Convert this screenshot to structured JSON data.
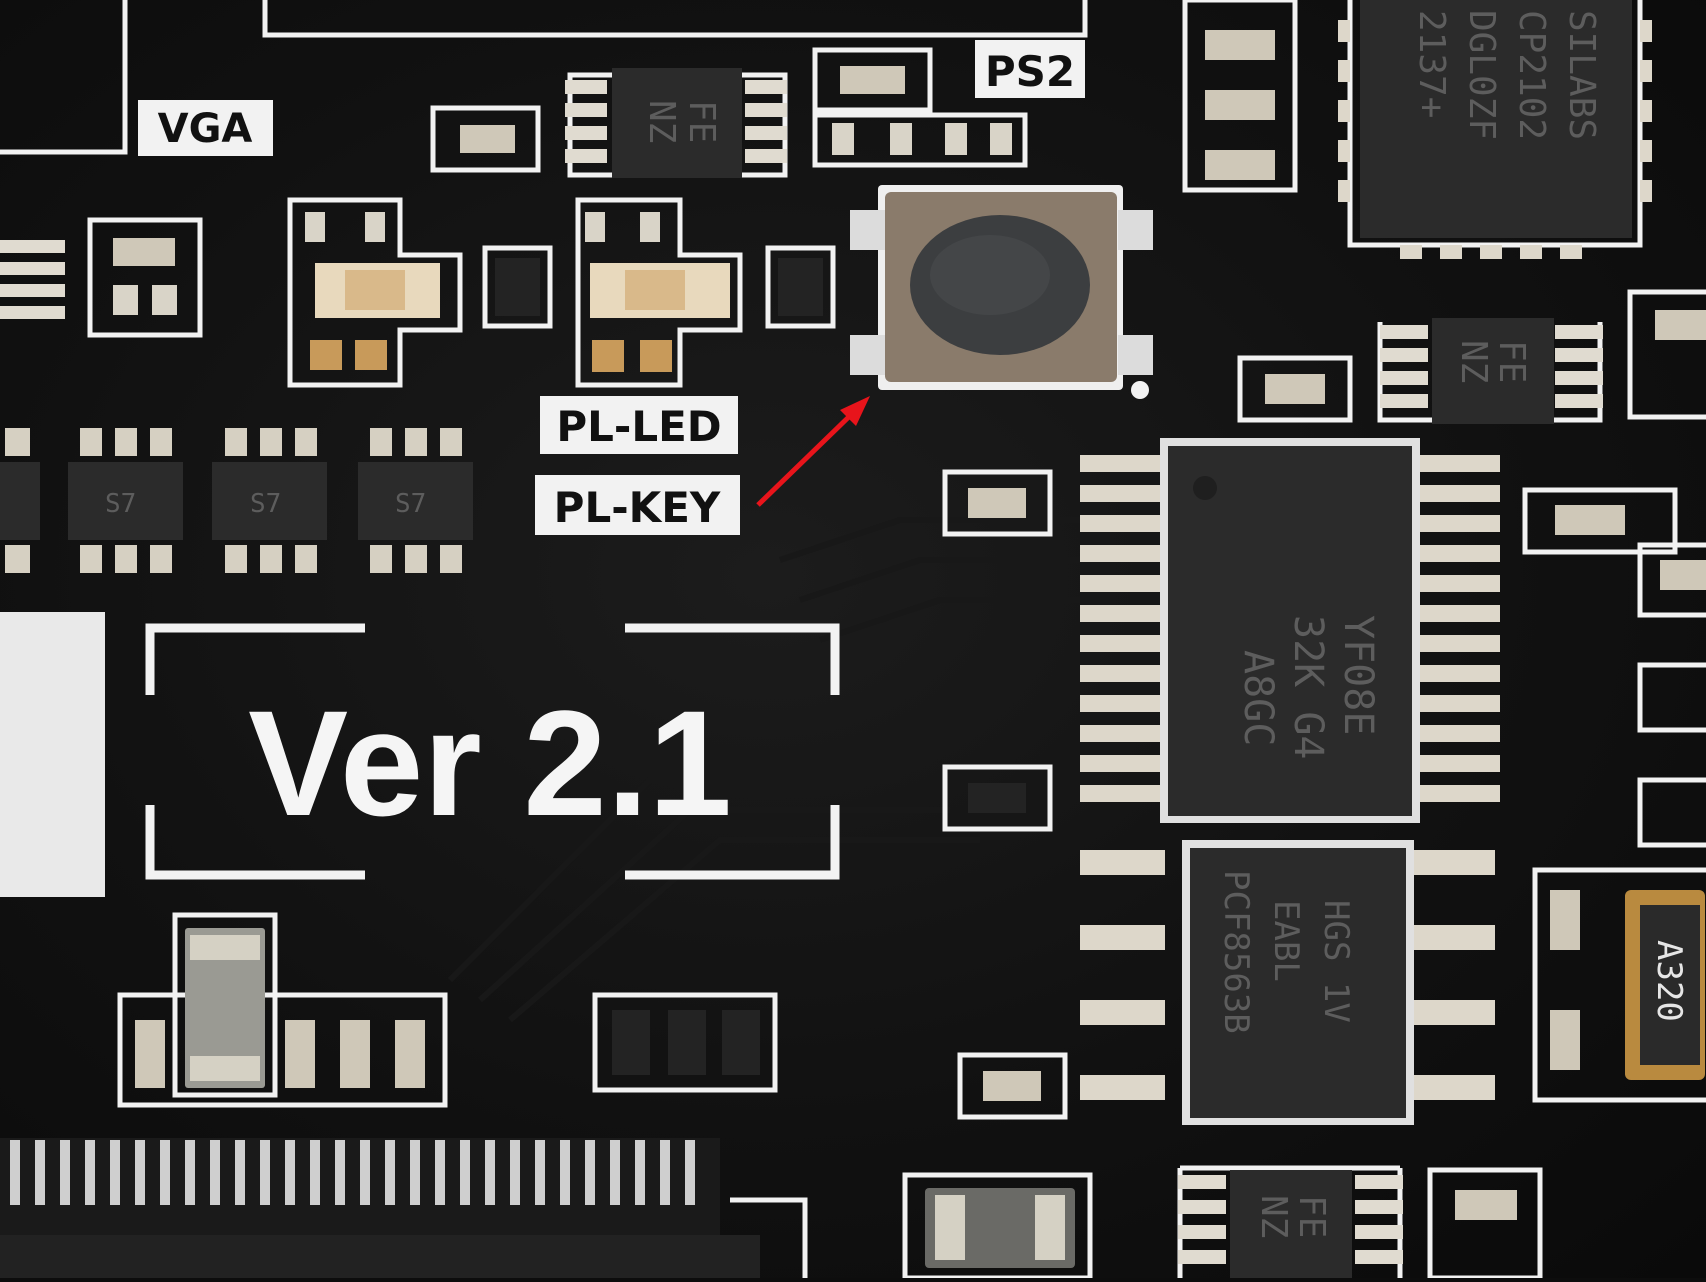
{
  "silkscreen": {
    "vga": "VGA",
    "ps2": "PS2",
    "pl_led": "PL-LED",
    "pl_key": "PL-KEY",
    "version": "Ver 2.1"
  },
  "chips": {
    "usb_uart": [
      "SILABS",
      "CP2102",
      "DGL0ZF",
      "2137+"
    ],
    "fe_nz_top": [
      "FE",
      "NZ"
    ],
    "fe_nz_right": [
      "FE",
      "NZ"
    ],
    "fe_nz_bottom": [
      "FE",
      "NZ"
    ],
    "ti_buffer": [
      "YF08E",
      "32K G4",
      "A8GC"
    ],
    "rtc": [
      "PCF8563B",
      "EABL",
      "HGS 1V"
    ],
    "crystal": "A320",
    "transistor_mark": "S7"
  },
  "annotation": {
    "arrow_color": "#e8141b",
    "points_to": "push-button"
  },
  "colors": {
    "pcb": "#111111",
    "silkscreen": "#f2f2f2",
    "pad_gold": "#c89a5a"
  }
}
